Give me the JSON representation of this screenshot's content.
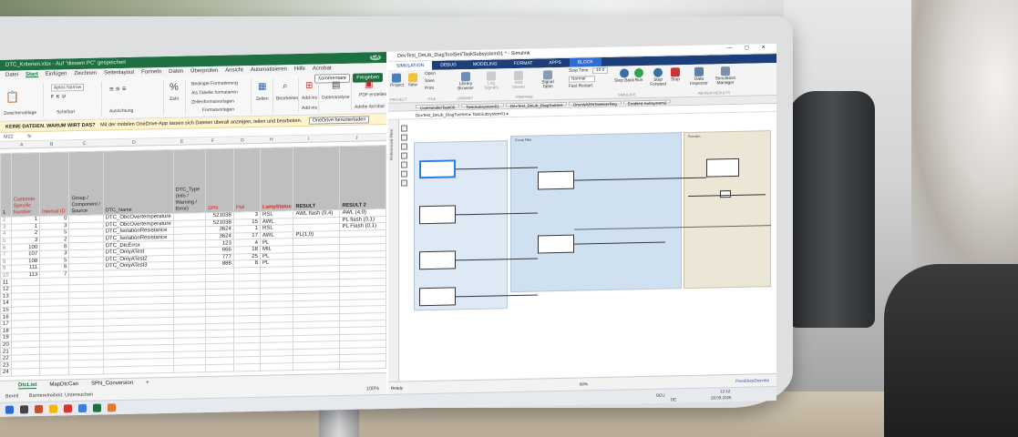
{
  "excel": {
    "title": "DTC_Kriterien.xlsx - Auf \"diesem PC\" gespeichert",
    "avatar": "CA",
    "tabs": [
      "Datei",
      "Start",
      "Einfügen",
      "Zeichnen",
      "Seitenlayout",
      "Formeln",
      "Daten",
      "Überprüfen",
      "Ansicht",
      "Automatisieren",
      "Hilfe",
      "Acrobat"
    ],
    "active_tab": "Start",
    "comments_label": "Kommentare",
    "share_label": "Freigeben",
    "ribbon": {
      "font": "Aptos Narrow",
      "number": "Zahl",
      "cond_format": "Bedingte Formatierung",
      "as_table": "Als Tabelle formatieren",
      "cell_styles": "Zellenformatvorlagen",
      "styles_group": "Formatvorlagen",
      "cells": "Zellen",
      "edit": "Bearbeiten",
      "addins": "Add-ins",
      "data_analysis": "Datenanalyse",
      "pdf": "PDF erstellen",
      "clipboard": "Zwischenablage",
      "font_group": "Schriftart",
      "align_group": "Ausrichtung",
      "addins_group": "Add-ins",
      "acrobat_group": "Adobe Acrobat"
    },
    "info_bar": {
      "bold": "KEINE DATEIEN. WARUM WIRT DAS?",
      "text": "Mit der mobilen OneDrive-App lassen sich Dateien überall anzeigen, teilen und bearbeiten.",
      "button": "OneDrive herunterladen"
    },
    "cell_ref": "M22",
    "columns": [
      "A",
      "B",
      "C",
      "D",
      "E",
      "F",
      "G",
      "H",
      "I",
      "J"
    ],
    "headers": [
      "Customer Specific Number",
      "Internal ID",
      "Group / Component / Source",
      "DTC_Name",
      "DTC_Type (Info / Warning / Error)",
      "SPN",
      "FMI",
      "LampStatus",
      "RESULT",
      "RESULT 2"
    ],
    "rows": [
      [
        "1",
        "0",
        "",
        "DTC_ObcOvertemperature",
        "",
        "521038",
        "3",
        "RSL",
        "AWL flash (0,4)",
        "AWL (4,0)"
      ],
      [
        "1",
        "3",
        "",
        "DTC_ObcOvertemperature",
        "",
        "521038",
        "15",
        "AWL",
        "",
        "PL flash (0,1)"
      ],
      [
        "2",
        "5",
        "",
        "DTC_IsolationResistance",
        "",
        "3624",
        "1",
        "RSL",
        "",
        "PL Flash (0,1)"
      ],
      [
        "3",
        "2",
        "",
        "DTC_IsolationResistance",
        "",
        "3624",
        "17",
        "AWL",
        "PL(1,0)",
        ""
      ],
      [
        "100",
        "6",
        "",
        "DTC_DtcError",
        "",
        "123",
        "4",
        "PL",
        "",
        ""
      ],
      [
        "107",
        "3",
        "",
        "DTC_OnlyATest",
        "",
        "666",
        "18",
        "MIL",
        "",
        ""
      ],
      [
        "108",
        "5",
        "",
        "DTC_OnlyATest2",
        "",
        "777",
        "25",
        "PL",
        "",
        ""
      ],
      [
        "111",
        "6",
        "",
        "DTC_OnlyATest3",
        "",
        "888",
        "8",
        "PL",
        "",
        ""
      ],
      [
        "113",
        "7",
        "",
        "",
        "",
        "",
        "",
        "",
        "",
        ""
      ]
    ],
    "sheets": [
      "DtcList",
      "MapDtcCan",
      "SPN_Conversion"
    ],
    "active_sheet": "DtcList",
    "zoom": "100%",
    "status": "Bereit",
    "accessibility": "Barrierefreiheit: Untersuchen"
  },
  "simulink": {
    "title": "DevTest_DeLib_DiagToolSet/TaskSubsystem01 * - Simulink",
    "tabs": [
      "SIMULATION",
      "DEBUG",
      "MODELING",
      "FORMAT",
      "APPS",
      "BLOCK"
    ],
    "active_tab": "SIMULATION",
    "ribbon": {
      "project": "Project",
      "new": "New",
      "open": "Open",
      "save": "Save",
      "print": "Print",
      "library": "Library Browser",
      "log_signals": "Log Signals",
      "add_viewer": "Add Viewer",
      "signal_table": "Signal Table",
      "stop_time_label": "Stop Time",
      "stop_time": "10.0",
      "mode": "Normal",
      "fast_restart": "Fast Restart",
      "step_back": "Step Back",
      "run": "Run",
      "step_forward": "Step Forward",
      "stop": "Stop",
      "data_inspector": "Data Inspector",
      "sim_manager": "Simulation Manager",
      "grp_project": "PROJECT",
      "grp_file": "FILE",
      "grp_library": "LIBRARY",
      "grp_prepare": "PREPARE",
      "grp_simulate": "SIMULATE",
      "grp_review": "REVIEW RESULTS"
    },
    "breadcrumbs": [
      "CanHandlerTask00",
      "TaskSubsystem01",
      "DevTest_DeLib_DiagToolSet",
      "DmcWARNTaWriterReg",
      "Enabled Subsystem2"
    ],
    "address": "DevTest_DeLib_DiagToolSet ▸ TaskSubsystem01 ▸",
    "side_label": "Referenced Files",
    "zoom": "80%",
    "status": "Ready",
    "solver": "FixedStepDiscrete",
    "zone_labels": [
      "Group Filter",
      "Function"
    ]
  },
  "taskbar": {
    "lang": "DEU",
    "lang2": "DE",
    "time": "12:12",
    "date": "28.05.2025"
  },
  "colors": {
    "excel_green": "#1e6f42",
    "simulink_blue": "#1c3f7a",
    "block_tab": "#2f6dd6"
  }
}
